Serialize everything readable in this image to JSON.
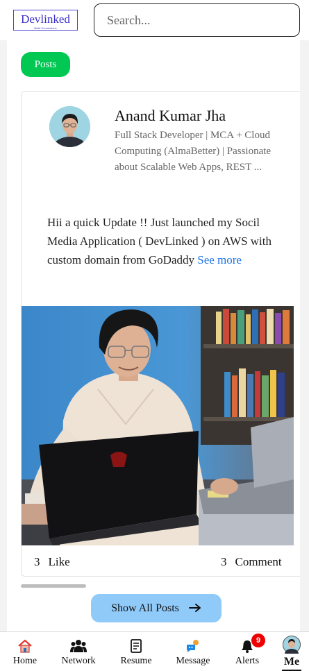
{
  "header": {
    "logo_text": "Devlinked",
    "logo_tagline": "Build Connections",
    "search_placeholder": "Search..."
  },
  "filter": {
    "posts_label": "Posts"
  },
  "post": {
    "author": "Anand Kumar Jha",
    "headline": "Full Stack Developer | MCA + Cloud Computing (AlmaBetter) | Passionate about Scalable Web Apps, REST  ...",
    "body": "Hii a quick Update !! Just launched my Socil Media Application ( DevLinked ) on AWS with custom domain from GoDaddy",
    "see_more": "See more",
    "like_count": "3",
    "like_label": "Like",
    "comment_count": "3",
    "comment_label": "Comment"
  },
  "show_all_label": "Show All Posts",
  "nav": {
    "items": [
      {
        "label": "Home",
        "icon": "home-icon",
        "color": "#e53935"
      },
      {
        "label": "Network",
        "icon": "people-icon"
      },
      {
        "label": "Resume",
        "icon": "document-icon"
      },
      {
        "label": "Message",
        "icon": "chat-icon",
        "color": "#1e88e5"
      },
      {
        "label": "Alerts",
        "icon": "bell-icon",
        "badge": "9"
      },
      {
        "label": "Me",
        "icon": "avatar"
      }
    ]
  },
  "colors": {
    "accent": "#00c853",
    "link": "#1a73e8",
    "button_light_blue": "#90caf9",
    "badge_red": "#e00000",
    "logo_blue": "#3a2fc9"
  }
}
